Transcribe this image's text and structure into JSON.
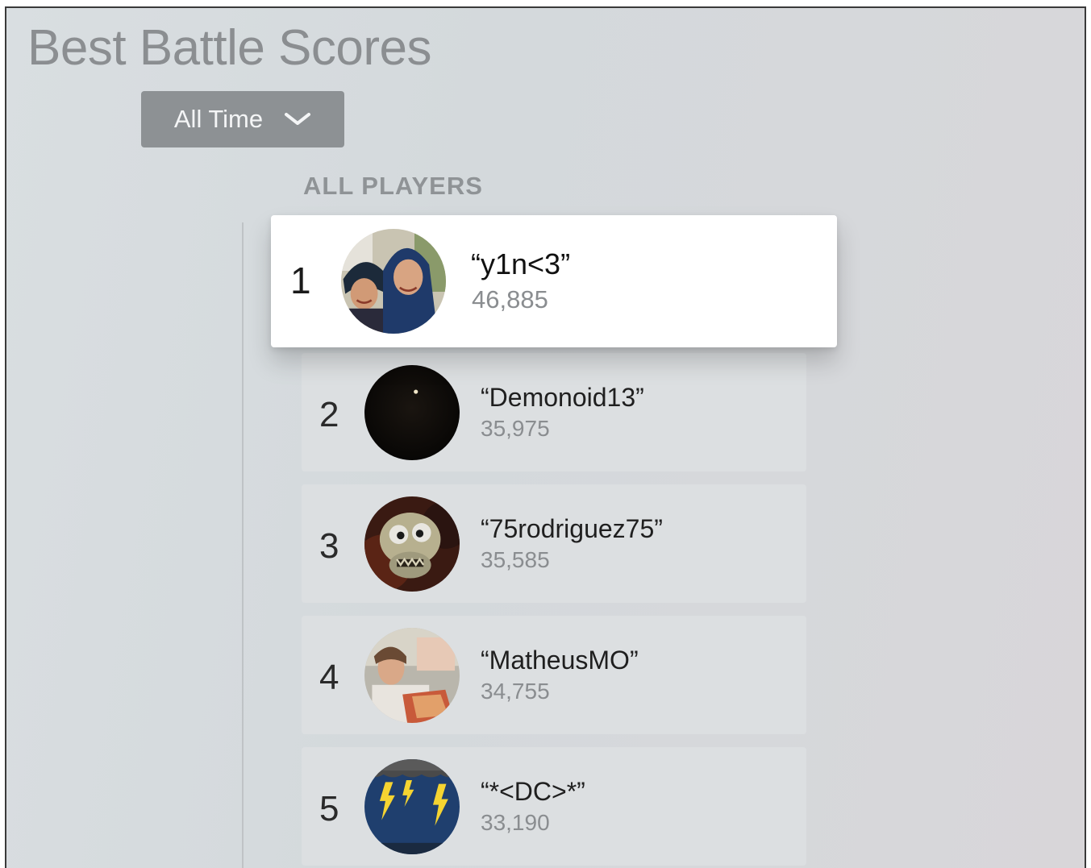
{
  "header": {
    "title": "Best Battle Scores"
  },
  "filter": {
    "label": "All Time",
    "icon": "chevron-down-icon"
  },
  "section": {
    "title": "ALL PLAYERS"
  },
  "leaderboard": [
    {
      "rank": "1",
      "name": "“y1n<3”",
      "score": "46,885",
      "avatar": "photo-two-people-avatar",
      "focused": true
    },
    {
      "rank": "2",
      "name": "“Demonoid13”",
      "score": "35,975",
      "avatar": "dark-avatar",
      "focused": false
    },
    {
      "rank": "3",
      "name": "“75rodriguez75”",
      "score": "35,585",
      "avatar": "skull-avatar",
      "focused": false
    },
    {
      "rank": "4",
      "name": "“MatheusMO”",
      "score": "34,755",
      "avatar": "photo-person-avatar",
      "focused": false
    },
    {
      "rank": "5",
      "name": "“*<DC>*”",
      "score": "33,190",
      "avatar": "lightning-avatar",
      "focused": false
    }
  ],
  "colors": {
    "background": "#d6dadd",
    "focused_row": "#ffffff",
    "row": "#dcdfe1",
    "filter_button": "#8d9194",
    "title_text": "#8b8e91"
  }
}
